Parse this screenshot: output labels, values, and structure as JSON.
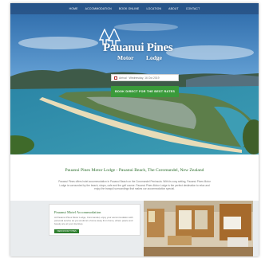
{
  "nav": {
    "items": [
      "HOME",
      "ACCOMMODATION",
      "BOOK ONLINE",
      "LOCATION",
      "ABOUT",
      "CONTACT"
    ]
  },
  "logo": {
    "name": "Pauanui Pines",
    "sub_left": "Motor",
    "sub_right": "Lodge"
  },
  "booking": {
    "date_placeholder": "Arrival · Wednesday, 16 Oct 2019",
    "button_label": "BOOK DIRECT FOR THE BEST RATES"
  },
  "main": {
    "heading": "Pauanui Pines Motor Lodge - Pauanui Beach, The Coromandel, New Zealand",
    "intro": "Pauanui Pines offers hotel accommodation in Pauanui Beach on the Coromandel Peninsula. With its cosy setting, Pauanui Pines Motor Lodge is surrounded by the beach, shops, cafe and the golf course. Pauanui Pines Motor Lodge is the perfect destination to relax and enjoy the tranquil surroundings that makes our accommodation special."
  },
  "card": {
    "title": "Pauanui Motel Accommodation",
    "text": "At Pauanui Pines Motor Lodge, Coromandel, enjoy your accommodation with personal service as you would at a home away from home, where peace and beauty are at your doorstep.",
    "button_label": "VIEW ROOM TYPES"
  },
  "colors": {
    "accent_green": "#3a9a3a",
    "heading_green": "#2c6e2c",
    "nav_bg": "#23416e"
  }
}
